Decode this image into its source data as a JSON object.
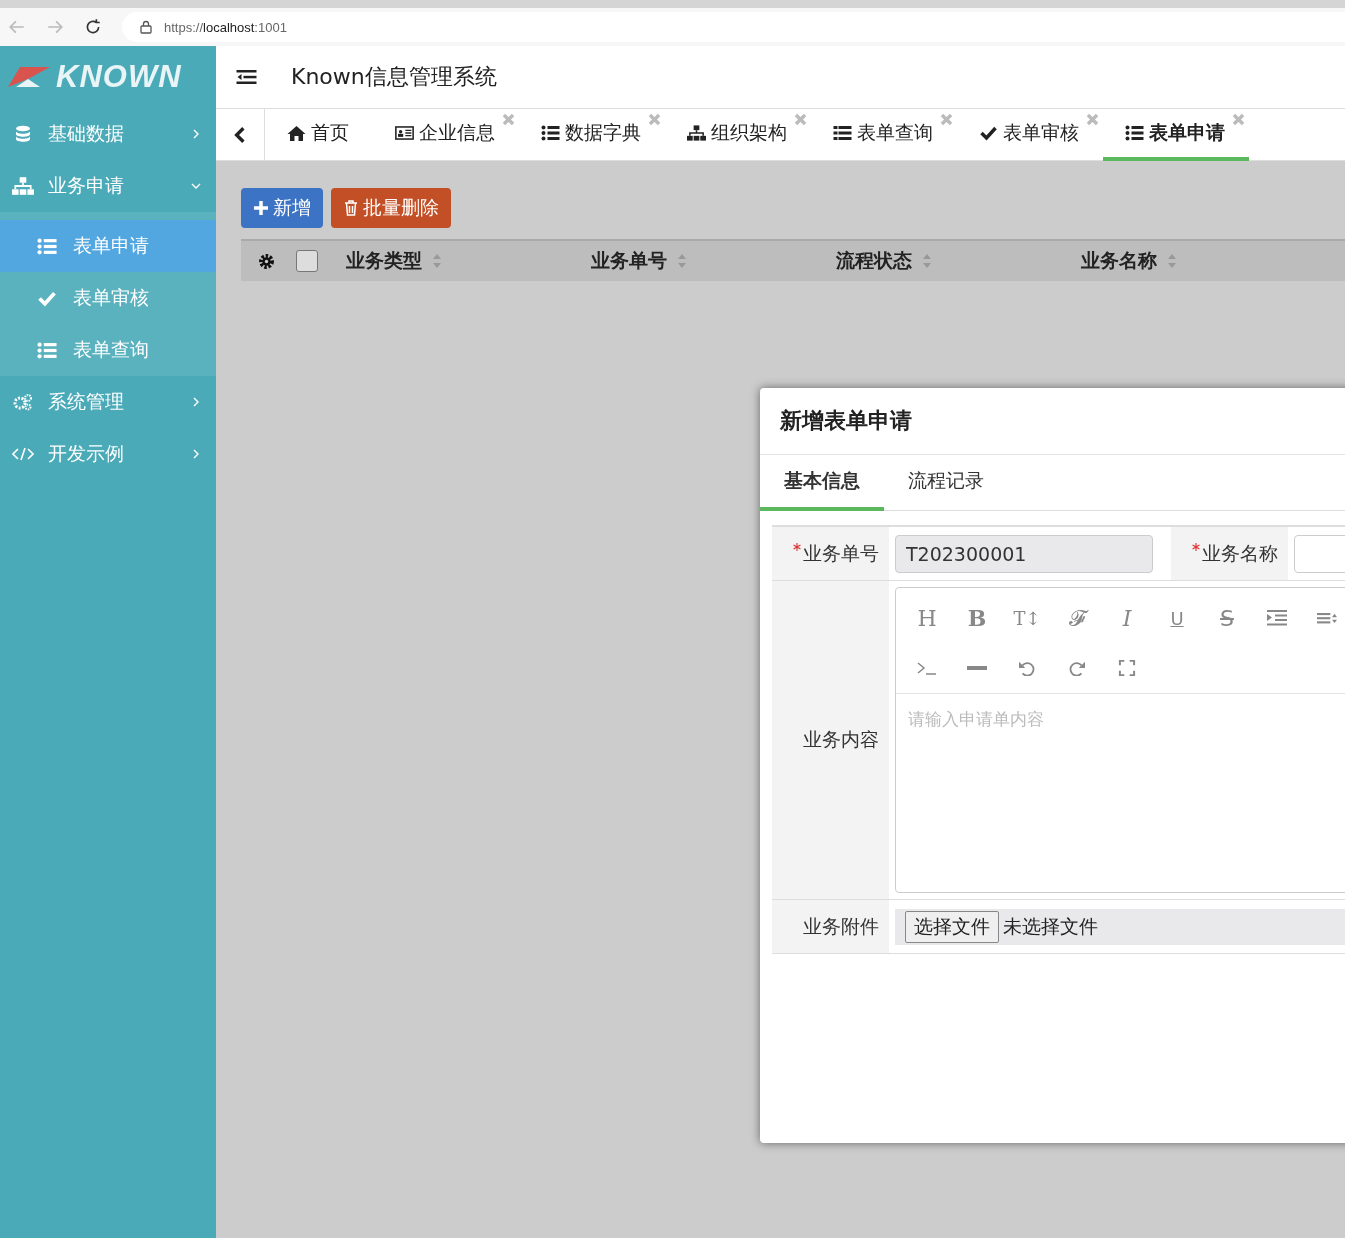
{
  "browser": {
    "url_prefix": "https://",
    "url_host": "localhost",
    "url_port": ":1001"
  },
  "sidebar": {
    "logo": "KNOWN",
    "items": [
      {
        "label": "基础数据",
        "expanded": false
      },
      {
        "label": "业务申请",
        "expanded": true,
        "children": [
          {
            "label": "表单申请",
            "selected": true
          },
          {
            "label": "表单审核",
            "selected": false
          },
          {
            "label": "表单查询",
            "selected": false
          }
        ]
      },
      {
        "label": "系统管理",
        "expanded": false
      },
      {
        "label": "开发示例",
        "expanded": false
      }
    ]
  },
  "header": {
    "title": "Known信息管理系统"
  },
  "tabs": [
    {
      "label": "首页",
      "closable": false,
      "selected": false
    },
    {
      "label": "企业信息",
      "closable": true,
      "selected": false
    },
    {
      "label": "数据字典",
      "closable": true,
      "selected": false
    },
    {
      "label": "组织架构",
      "closable": true,
      "selected": false
    },
    {
      "label": "表单查询",
      "closable": true,
      "selected": false
    },
    {
      "label": "表单审核",
      "closable": true,
      "selected": false
    },
    {
      "label": "表单申请",
      "closable": true,
      "selected": true
    }
  ],
  "toolbar": [
    {
      "label": "新增",
      "kind": "add"
    },
    {
      "label": "批量删除",
      "kind": "delete"
    }
  ],
  "table": {
    "checked": false,
    "columns": [
      "业务类型",
      "业务单号",
      "流程状态",
      "业务名称"
    ]
  },
  "dialog": {
    "title": "新增表单申请",
    "tabs": [
      {
        "label": "基本信息",
        "selected": true
      },
      {
        "label": "流程记录",
        "selected": false
      }
    ],
    "fields": [
      {
        "label": "业务单号",
        "required": true,
        "value": "T202300001",
        "disabled": true
      },
      {
        "label": "业务名称",
        "required": true,
        "disabled": false
      }
    ],
    "content": {
      "label": "业务内容",
      "placeholder": "请输入申请单内容",
      "tools": [
        {
          "kind": "glyph",
          "text": "H"
        },
        {
          "kind": "glyph",
          "text": "B"
        },
        {
          "kind": "glyph",
          "text": "T↕"
        },
        {
          "kind": "glyph",
          "text": "𝓕"
        },
        {
          "kind": "glyph",
          "text": "I"
        },
        {
          "kind": "glyph",
          "text": "U"
        },
        {
          "kind": "glyph",
          "text": "S"
        },
        {
          "kind": "indent"
        },
        {
          "kind": "align"
        },
        {
          "kind": "code"
        },
        {
          "kind": "rule"
        },
        {
          "kind": "undo"
        },
        {
          "kind": "redo"
        },
        {
          "kind": "fullscreen"
        }
      ]
    },
    "attachment": {
      "label": "业务附件",
      "button": "选择文件",
      "status": "未选择文件"
    }
  }
}
